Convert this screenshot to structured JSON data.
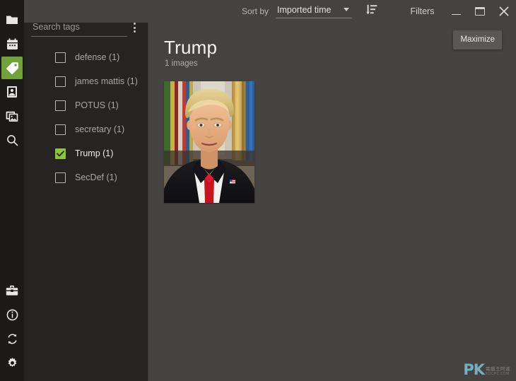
{
  "window": {
    "controls": {
      "minimize_label": "Minimize",
      "maximize_label": "Maximize",
      "close_label": "Close"
    },
    "tooltip": "Maximize"
  },
  "rail": {
    "top_items": [
      {
        "id": "folders",
        "icon": "folder-icon",
        "label": "Folders",
        "active": false
      },
      {
        "id": "calendar",
        "icon": "calendar-icon",
        "label": "Calendar",
        "active": false
      },
      {
        "id": "tags",
        "icon": "tag-icon",
        "label": "Tags",
        "active": true
      },
      {
        "id": "people",
        "icon": "person-photo-icon",
        "label": "People",
        "active": false
      },
      {
        "id": "albums",
        "icon": "albums-icon",
        "label": "Albums",
        "active": false
      },
      {
        "id": "search",
        "icon": "magnifier-icon",
        "label": "Search",
        "active": false
      }
    ],
    "bottom_items": [
      {
        "id": "toolbox",
        "icon": "toolbox-icon",
        "label": "Tools",
        "active": false
      },
      {
        "id": "info",
        "icon": "info-icon",
        "label": "Info",
        "active": false
      },
      {
        "id": "sync",
        "icon": "sync-icon",
        "label": "Sync",
        "active": false
      },
      {
        "id": "settings",
        "icon": "gear-icon",
        "label": "Settings",
        "active": false
      }
    ],
    "active_accent": "#6fa239"
  },
  "tag_sidebar": {
    "search": {
      "placeholder": "Search tags",
      "value": ""
    },
    "menu_label": "More options",
    "tags": [
      {
        "name": "defense",
        "count_label": "defense (1)",
        "checked": false
      },
      {
        "name": "james mattis",
        "count_label": "james mattis (1)",
        "checked": false
      },
      {
        "name": "POTUS",
        "count_label": "POTUS (1)",
        "checked": false
      },
      {
        "name": "secretary",
        "count_label": "secretary (1)",
        "checked": false
      },
      {
        "name": "Trump",
        "count_label": "Trump (1)",
        "checked": true
      },
      {
        "name": "SecDef",
        "count_label": "SecDef (1)",
        "checked": false
      }
    ],
    "checked_color": "#8cc540"
  },
  "toolbar": {
    "sort_by_label": "Sort by",
    "sort_value": "Imported time",
    "sort_direction_icon": "sort-descending-icon",
    "filters_label": "Filters"
  },
  "gallery": {
    "title": "Trump",
    "subtitle": "1 images",
    "thumbnails": [
      {
        "alt": "Portrait photograph of a man in a dark suit with red tie"
      }
    ]
  },
  "watermark": {
    "logo": "PK",
    "line1": "電腦王阿達",
    "line2": "KOCPC.COM"
  },
  "theme": {
    "rail_bg": "#1b1a19",
    "sidebar_bg": "#262423",
    "main_bg": "#454341",
    "accent": "#8cc540",
    "text_primary": "#ececec",
    "text_muted": "#a9a7a5"
  }
}
